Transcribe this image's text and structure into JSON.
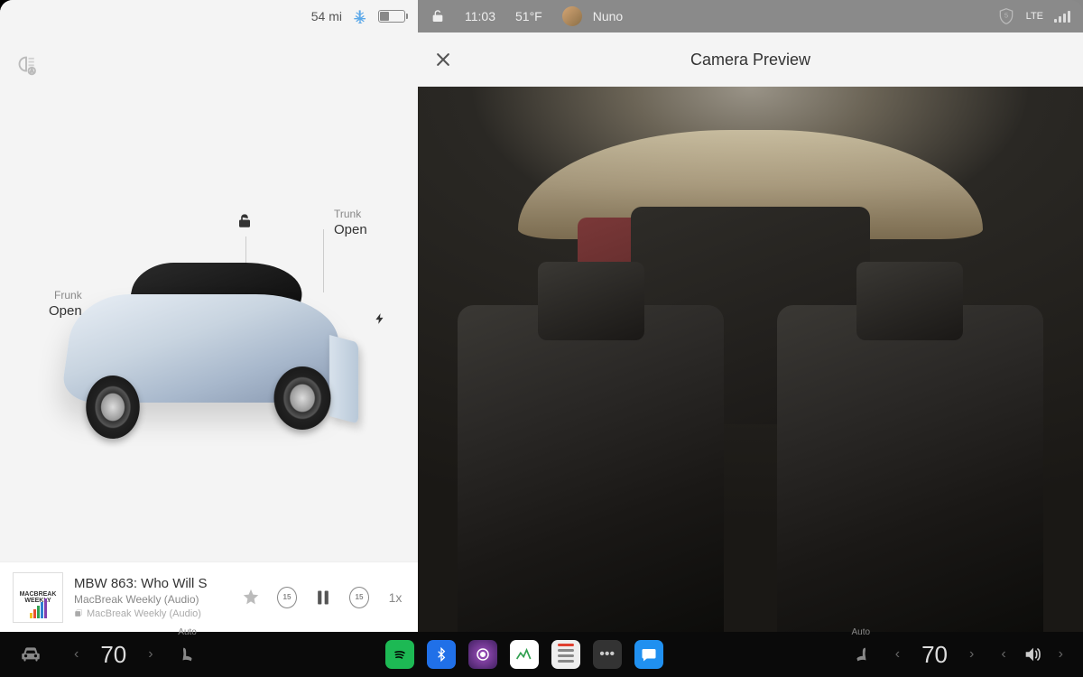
{
  "status": {
    "range": "54 mi",
    "time": "11:03",
    "temp_outside": "51°F",
    "driver_name": "Nuno",
    "network_type": "LTE",
    "shield_badge": "5"
  },
  "vehicle": {
    "frunk_label": "Frunk",
    "frunk_state": "Open",
    "trunk_label": "Trunk",
    "trunk_state": "Open",
    "lock_state": "unlocked",
    "charging": true
  },
  "media": {
    "artwork_text_1": "MACBREAK",
    "artwork_text_2": "WEEKLY",
    "title": "MBW 863: Who Will S",
    "subtitle": "MacBreak Weekly (Audio)",
    "source": "MacBreak Weekly (Audio)",
    "skip_back": "15",
    "skip_fwd": "15",
    "speed": "1x"
  },
  "camera": {
    "title": "Camera Preview"
  },
  "climate": {
    "left_temp": "70",
    "right_temp": "70",
    "left_mode": "Auto",
    "right_mode": "Auto"
  },
  "apps": {
    "spotify": "spotify",
    "bluetooth": "bluetooth",
    "camera": "dashcam",
    "energy": "energy",
    "toybox": "toybox",
    "more": "more",
    "messages": "messages"
  }
}
